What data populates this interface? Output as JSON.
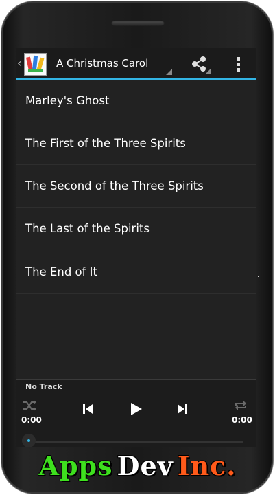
{
  "app": {
    "title": "A Christmas Carol"
  },
  "chapters": [
    {
      "label": "Marley's Ghost"
    },
    {
      "label": "The First of the Three Spirits"
    },
    {
      "label": "The Second of the Three Spirits"
    },
    {
      "label": "The Last of the Spirits"
    },
    {
      "label": "The End of It"
    }
  ],
  "player": {
    "track": "No Track",
    "elapsed": "0:00",
    "duration": "0:00",
    "progress": 0
  },
  "branding": {
    "word1": "Apps",
    "word2": "Dev",
    "word3": "Inc."
  },
  "colors": {
    "accent": "#33b5e5",
    "background": "#222222",
    "brand_green": "#3ee01e",
    "brand_orange": "#ff5a1a"
  },
  "icons": {
    "up": "chevron-left-icon",
    "share": "share-icon",
    "overflow": "overflow-menu-icon",
    "shuffle": "shuffle-icon",
    "previous": "skip-previous-icon",
    "play": "play-icon",
    "next": "skip-next-icon",
    "repeat": "repeat-icon"
  }
}
